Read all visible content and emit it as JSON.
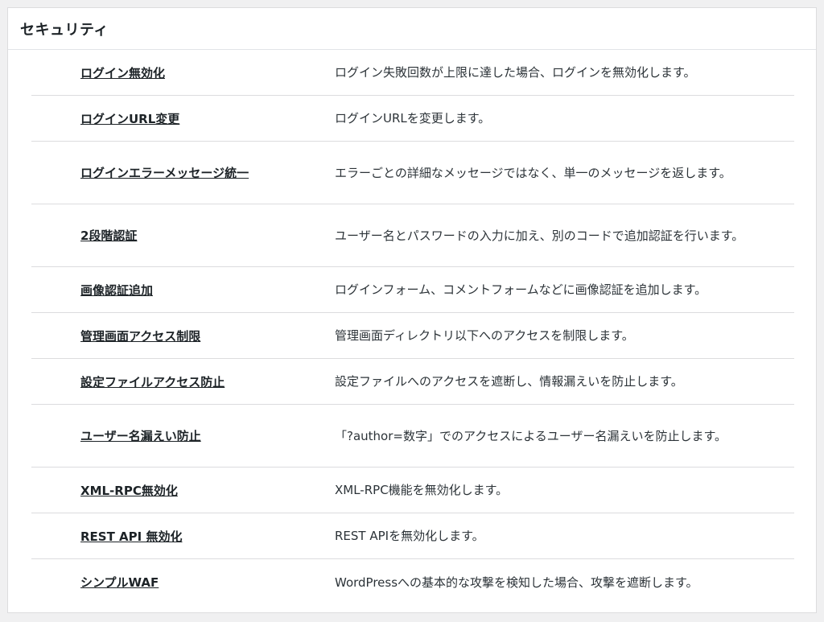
{
  "panel": {
    "title": "セキュリティ"
  },
  "settings": [
    {
      "name": "ログイン無効化",
      "description": "ログイン失敗回数が上限に達した場合、ログインを無効化します。"
    },
    {
      "name": "ログインURL変更",
      "description": "ログインURLを変更します。"
    },
    {
      "name": "ログインエラーメッセージ統一",
      "description": "エラーごとの詳細なメッセージではなく、単一のメッセージを返します。"
    },
    {
      "name": "2段階認証",
      "description": "ユーザー名とパスワードの入力に加え、別のコードで追加認証を行います。"
    },
    {
      "name": "画像認証追加",
      "description": "ログインフォーム、コメントフォームなどに画像認証を追加します。"
    },
    {
      "name": "管理画面アクセス制限",
      "description": "管理画面ディレクトリ以下へのアクセスを制限します。"
    },
    {
      "name": "設定ファイルアクセス防止",
      "description": "設定ファイルへのアクセスを遮断し、情報漏えいを防止します。"
    },
    {
      "name": "ユーザー名漏えい防止",
      "description": "「?author=数字」でのアクセスによるユーザー名漏えいを防止します。"
    },
    {
      "name": "XML-RPC無効化",
      "description": "XML-RPC機能を無効化します。"
    },
    {
      "name": "REST API 無効化",
      "description": "REST APIを無効化します。"
    },
    {
      "name": "シンプルWAF",
      "description": "WordPressへの基本的な攻撃を検知した場合、攻撃を遮断します。"
    }
  ]
}
